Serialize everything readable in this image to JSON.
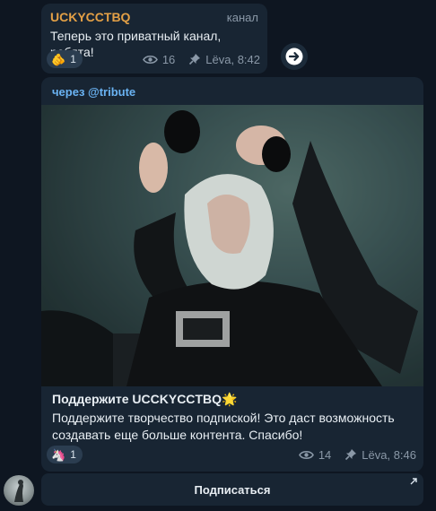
{
  "message1": {
    "sender": "UCKYCCTBQ",
    "tag": "канал",
    "text": "Теперь это приватный канал, ребята!",
    "reaction": {
      "emoji": "🫵",
      "count": "1"
    },
    "views": "16",
    "time": "Lëva, 8:42"
  },
  "message2": {
    "via": "через @tribute",
    "title": "Поддержите UCCKYCCTBQ🌟",
    "description": "Поддержите творчество подпиской! Это даст возможность создавать еще больше контента. Спасибо!",
    "reaction": {
      "emoji": "🦄",
      "count": "1"
    },
    "views": "14",
    "time": "Lëva, 8:46"
  },
  "subscribe_label": "Подписаться",
  "colors": {
    "background": "#0e1621",
    "bubble": "#182533",
    "sender": "#e3a046",
    "link": "#6ab3f3"
  },
  "icons": [
    "views-eye-icon",
    "pin-icon",
    "forward-arrow-icon",
    "external-arrow-icon"
  ]
}
